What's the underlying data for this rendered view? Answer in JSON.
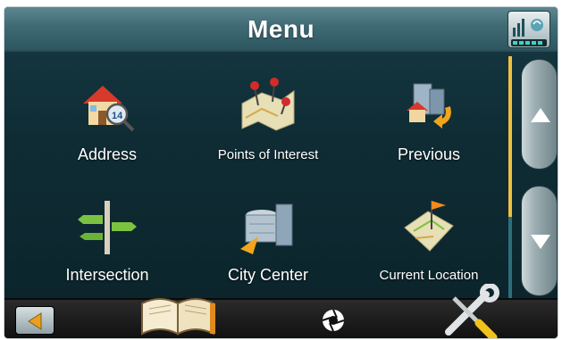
{
  "header": {
    "title": "Menu"
  },
  "menu": {
    "items": [
      {
        "label": "Address",
        "icon": "house-address-icon"
      },
      {
        "label": "Points of Interest",
        "icon": "map-pins-icon"
      },
      {
        "label": "Previous",
        "icon": "recent-buildings-icon"
      },
      {
        "label": "Intersection",
        "icon": "signpost-icon"
      },
      {
        "label": "City Center",
        "icon": "city-buildings-icon"
      },
      {
        "label": "Current Location",
        "icon": "map-flag-icon"
      }
    ]
  },
  "icons": {
    "status": "signal-battery-icon",
    "scroll_up": "arrow-up-icon",
    "scroll_down": "arrow-down-icon",
    "back": "arrow-left-icon",
    "book": "book-icon",
    "camera": "camera-shutter-icon",
    "tools": "tools-icon"
  },
  "scroll": {
    "position": 0.0,
    "visible_fraction": 0.66
  },
  "colors": {
    "background": "#0f2c34",
    "titlebar": "#3f6a74",
    "scroll_thumb": "#f0c040",
    "scroll_track": "#2d6e7c"
  }
}
